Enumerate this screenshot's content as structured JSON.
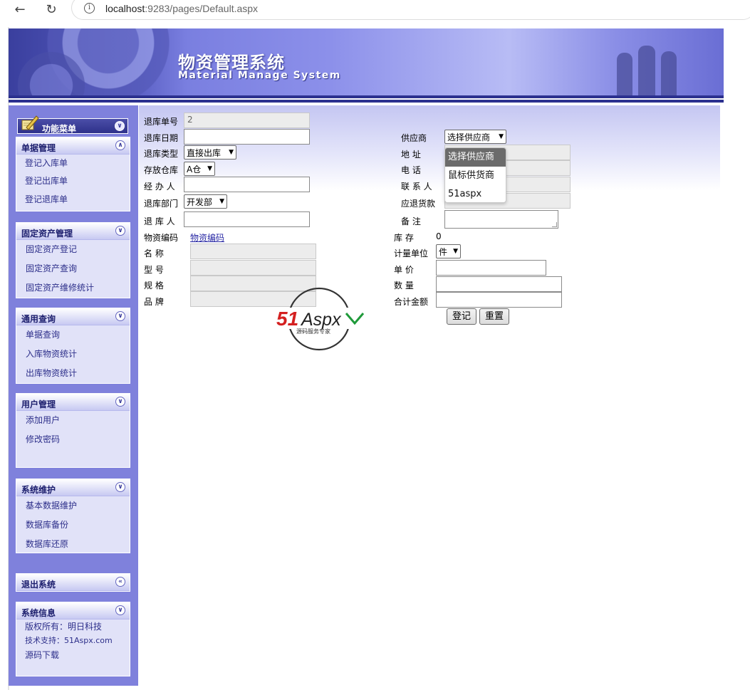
{
  "browser": {
    "url_host": "localhost",
    "url_rest": ":9283/pages/Default.aspx"
  },
  "banner": {
    "title_cn": "物资管理系统",
    "title_en": "Material Manage System"
  },
  "sidebar": {
    "func_menu": "功能菜单",
    "sections": [
      {
        "title": "单据管理",
        "items": [
          "登记入库单",
          "登记出库单",
          "登记退库单"
        ]
      },
      {
        "title": "固定资产管理",
        "items": [
          "固定资产登记",
          "固定资产查询",
          "固定资产维修统计"
        ]
      },
      {
        "title": "通用查询",
        "items": [
          "单据查询",
          "入库物资统计",
          "出库物资统计"
        ]
      },
      {
        "title": "用户管理",
        "items": [
          "添加用户",
          "修改密码"
        ]
      },
      {
        "title": "系统维护",
        "items": [
          "基本数据维护",
          "数据库备份",
          "数据库还原"
        ]
      },
      {
        "title": "退出系统",
        "items": []
      },
      {
        "title": "系统信息",
        "items": [
          "版权所有：明日科技",
          "技术支持：51Aspx.com",
          "源码下载"
        ]
      }
    ]
  },
  "form": {
    "labels": {
      "return_no": "退库单号",
      "return_date": "退库日期",
      "return_type": "退库类型",
      "warehouse": "存放仓库",
      "handler": "经 办 人",
      "dept": "退库部门",
      "returner": "退 库 人",
      "material_code": "物资编码",
      "name": "名 称",
      "model": "型 号",
      "spec": "规 格",
      "brand": "品 牌",
      "supplier": "供应商",
      "address": "地 址",
      "phone": "电 话",
      "contact": "联 系 人",
      "refund": "应退货款",
      "remark": "备 注",
      "stock": "库 存",
      "unit": "计量单位",
      "price": "单 价",
      "qty": "数 量",
      "total": "合计金额"
    },
    "values": {
      "return_no": "2",
      "return_type": "直接出库",
      "warehouse": "A仓",
      "dept": "开发部",
      "supplier": "选择供应商",
      "material_code_link": "物资编码",
      "stock": "0",
      "unit": "件"
    },
    "supplier_options": [
      "选择供应商",
      "鼠标供货商",
      "51aspx"
    ],
    "buttons": {
      "submit": "登记",
      "reset": "重置"
    }
  },
  "watermark": {
    "brand": "51Aspx",
    "tagline": "源码服务专家"
  },
  "colors": {
    "sidebar": "#7f81dc",
    "banner_dark": "#2c318f",
    "menu_text": "#2d2f8a"
  }
}
